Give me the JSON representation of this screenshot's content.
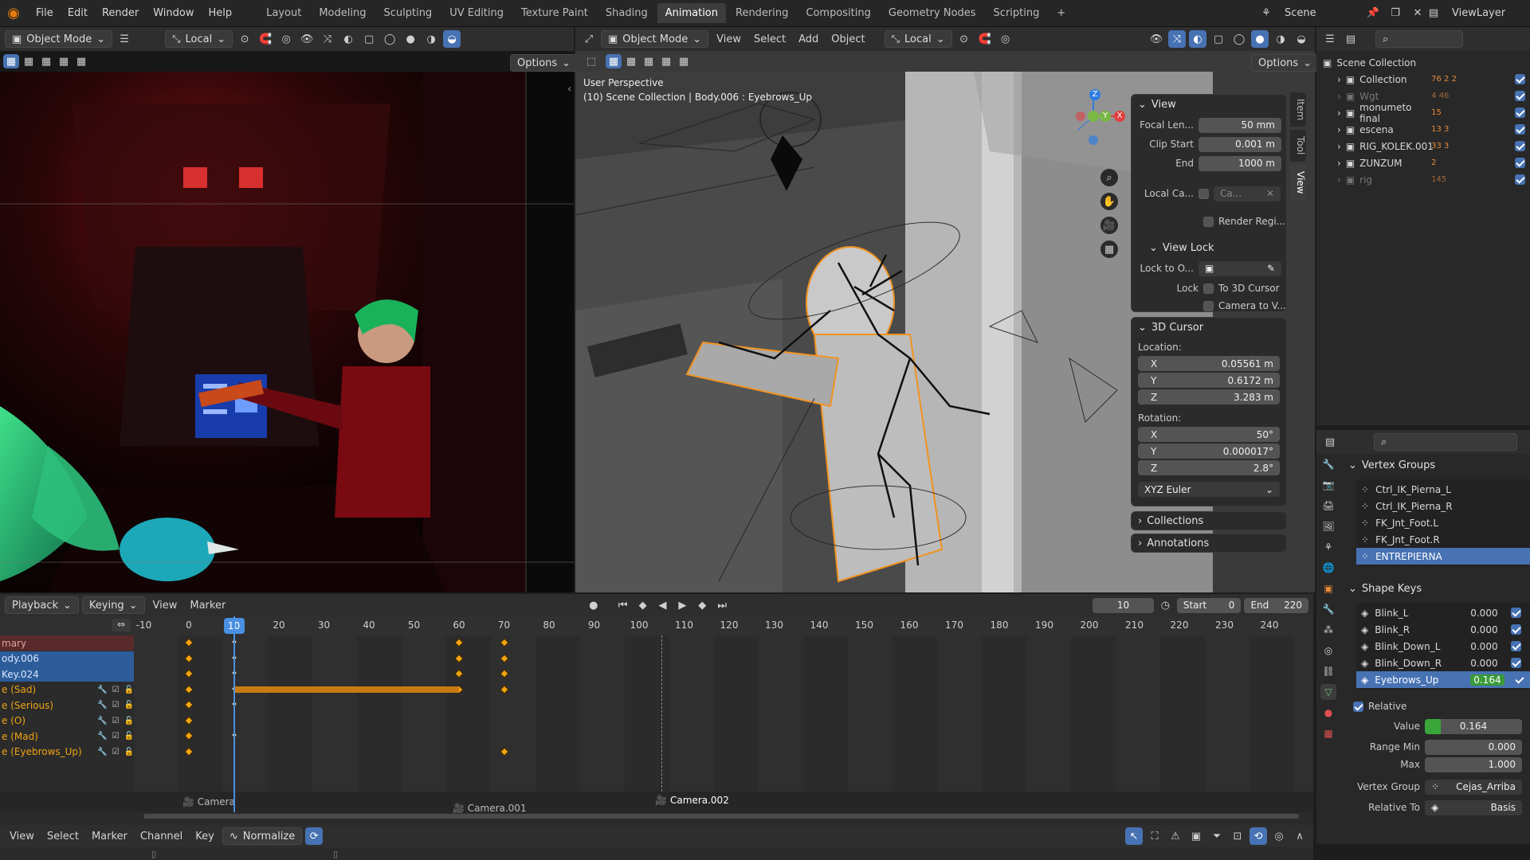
{
  "topbar": {
    "menus": [
      "File",
      "Edit",
      "Render",
      "Window",
      "Help"
    ],
    "workspaces": [
      "Layout",
      "Modeling",
      "Sculpting",
      "UV Editing",
      "Texture Paint",
      "Shading",
      "Animation",
      "Rendering",
      "Compositing",
      "Geometry Nodes",
      "Scripting"
    ],
    "active_workspace": "Animation",
    "add_tab": "+",
    "scene_name": "Scene",
    "view_layer": "ViewLayer"
  },
  "camera_view": {
    "mode": "Object Mode",
    "orientation": "Local",
    "options": "Options"
  },
  "viewport": {
    "mode": "Object Mode",
    "menus": [
      "View",
      "Select",
      "Add",
      "Object"
    ],
    "orientation": "Local",
    "options": "Options",
    "overlay_line1": "User Perspective",
    "overlay_line2": "(10) Scene Collection | Body.006 : Eyebrows_Up"
  },
  "npanel": {
    "view_header": "View",
    "focal_length_label": "Focal Len...",
    "focal_length": "50 mm",
    "clip_start_label": "Clip Start",
    "clip_start": "0.001 m",
    "clip_end_label": "End",
    "clip_end": "1000 m",
    "local_camera_label": "Local Ca...",
    "local_camera_value": "Ca...",
    "render_region": "Render Regi...",
    "view_lock_header": "View Lock",
    "lock_to_object_label": "Lock to O...",
    "lock_label": "Lock",
    "lock_3d_cursor": "To 3D Cursor",
    "lock_camera": "Camera to V...",
    "cursor_header": "3D Cursor",
    "location_label": "Location:",
    "loc_x": "0.05561 m",
    "loc_y": "0.6172 m",
    "loc_z": "3.283 m",
    "rotation_label": "Rotation:",
    "rot_x": "50°",
    "rot_y": "0.000017°",
    "rot_z": "2.8°",
    "rotation_mode": "XYZ Euler",
    "collections": "Collections",
    "annotations": "Annotations",
    "tabs": [
      "Item",
      "Tool",
      "View"
    ],
    "axis_x": "X",
    "axis_y": "Y",
    "axis_z": "Z"
  },
  "outliner": {
    "root": "Scene Collection",
    "items": [
      {
        "name": "Collection",
        "badge": "76  2  2"
      },
      {
        "name": "Wgt",
        "badge": "4  46"
      },
      {
        "name": "monumeto final",
        "badge": "15"
      },
      {
        "name": "escena",
        "badge": "13  3"
      },
      {
        "name": "RIG_KOLEK.001",
        "badge": "33  3"
      },
      {
        "name": "ZUNZUM",
        "badge": "2"
      },
      {
        "name": "rig",
        "badge": "145"
      }
    ]
  },
  "properties": {
    "vertex_groups_header": "Vertex Groups",
    "vertex_groups": [
      "Ctrl_IK_Pierna_L",
      "Ctrl_IK_Pierna_R",
      "FK_Jnt_Foot.L",
      "FK_Jnt_Foot.R",
      "ENTREPIERNA"
    ],
    "vertex_group_selected": 4,
    "shape_keys_header": "Shape Keys",
    "shape_keys": [
      {
        "name": "Blink_L",
        "value": "0.000"
      },
      {
        "name": "Blink_R",
        "value": "0.000"
      },
      {
        "name": "Blink_Down_L",
        "value": "0.000"
      },
      {
        "name": "Blink_Down_R",
        "value": "0.000"
      },
      {
        "name": "Eyebrows_Up",
        "value": "0.164"
      }
    ],
    "shape_key_selected": 4,
    "relative_label": "Relative",
    "value_label": "Value",
    "value": "0.164",
    "value_fraction": 0.164,
    "range_min_label": "Range Min",
    "range_min": "0.000",
    "max_label": "Max",
    "max": "1.000",
    "vertex_group_label": "Vertex Group",
    "vertex_group_value": "Cejas_Arriba",
    "relative_to_label": "Relative To",
    "relative_to_value": "Basis"
  },
  "dopesheet": {
    "menus": [
      "Playback",
      "Keying",
      "View",
      "Marker"
    ],
    "current_frame": "10",
    "start_label": "Start",
    "start": "0",
    "end_label": "End",
    "end": "220",
    "ruler": [
      "-10",
      "0",
      "10",
      "20",
      "30",
      "40",
      "50",
      "60",
      "70",
      "80",
      "90",
      "100",
      "110",
      "120",
      "130",
      "140",
      "150",
      "160",
      "170",
      "180",
      "190",
      "200",
      "210",
      "220",
      "230",
      "240"
    ],
    "channels": [
      {
        "name": "mary",
        "style": "summary"
      },
      {
        "name": "ody.006",
        "style": "object"
      },
      {
        "name": "Key.024",
        "style": "object"
      },
      {
        "name": "e (Sad)",
        "style": "key"
      },
      {
        "name": "e (Serious)",
        "style": "key"
      },
      {
        "name": "e (O)",
        "style": "key"
      },
      {
        "name": "e (Mad)",
        "style": "key"
      },
      {
        "name": "e (Eyebrows_Up)",
        "style": "key"
      }
    ],
    "markers": [
      "Camera",
      "Camera.001",
      "Camera.002"
    ],
    "bottom_menus": [
      "View",
      "Select",
      "Marker",
      "Channel",
      "Key"
    ],
    "normalize": "Normalize"
  },
  "colors": {
    "accent": "#4772b3",
    "keyframe": "#f0a413",
    "playhead": "#4a90e2",
    "selection": "#f59e1a"
  }
}
